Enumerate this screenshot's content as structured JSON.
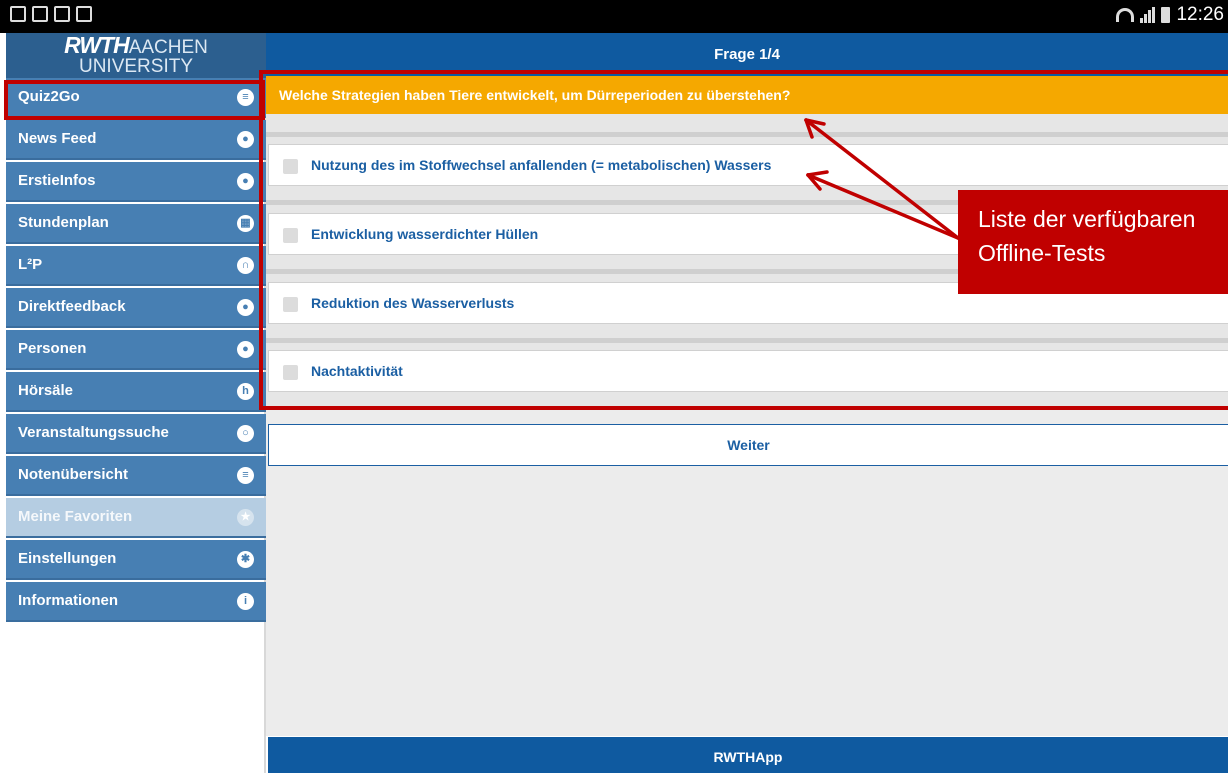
{
  "statusbar": {
    "clock": "12:26"
  },
  "sidebar": {
    "logo_line1_bold": "RWTH",
    "logo_line1_light": "AACHEN",
    "logo_line2": "UNIVERSITY",
    "items": [
      {
        "label": "Quiz2Go",
        "icon": "list-icon",
        "glyph": "≡"
      },
      {
        "label": "News Feed",
        "icon": "chat-bubble-icon",
        "glyph": "●"
      },
      {
        "label": "ErstieInfos",
        "icon": "chat-bubble-icon",
        "glyph": "●"
      },
      {
        "label": "Stundenplan",
        "icon": "calendar-icon",
        "glyph": "▦"
      },
      {
        "label": "L²P",
        "icon": "graduation-cap-icon",
        "glyph": "∩"
      },
      {
        "label": "Direktfeedback",
        "icon": "person-icon",
        "glyph": "●"
      },
      {
        "label": "Personen",
        "icon": "user-icon",
        "glyph": "●"
      },
      {
        "label": "Hörsäle",
        "icon": "lecture-hall-icon",
        "glyph": "h"
      },
      {
        "label": "Veranstaltungssuche",
        "icon": "search-icon",
        "glyph": "○"
      },
      {
        "label": "Notenübersicht",
        "icon": "list-icon",
        "glyph": "≡"
      },
      {
        "label": "Meine Favoriten",
        "icon": "star-icon",
        "glyph": "★"
      },
      {
        "label": "Einstellungen",
        "icon": "gear-icon",
        "glyph": "✱"
      },
      {
        "label": "Informationen",
        "icon": "info-icon",
        "glyph": "i"
      }
    ]
  },
  "main": {
    "title": "Frage 1/4",
    "question": "Welche Strategien haben Tiere entwickelt, um Dürreperioden zu überstehen?",
    "answers": [
      "Nutzung des im Stoffwechsel anfallenden (= metabolischen) Wassers",
      "Entwicklung wasserdichter Hüllen",
      "Reduktion des Wasserverlusts",
      "Nachtaktivität"
    ],
    "next_label": "Weiter",
    "footer": "RWTHApp"
  },
  "annotation": {
    "callout_line1": "Liste der verfügbaren",
    "callout_line2": "Offline-Tests",
    "color": "#c00000"
  },
  "colors": {
    "nav": "#477fb3",
    "header": "#0f5aa0",
    "question": "#f5a800",
    "answer_text": "#1b5fa3"
  }
}
